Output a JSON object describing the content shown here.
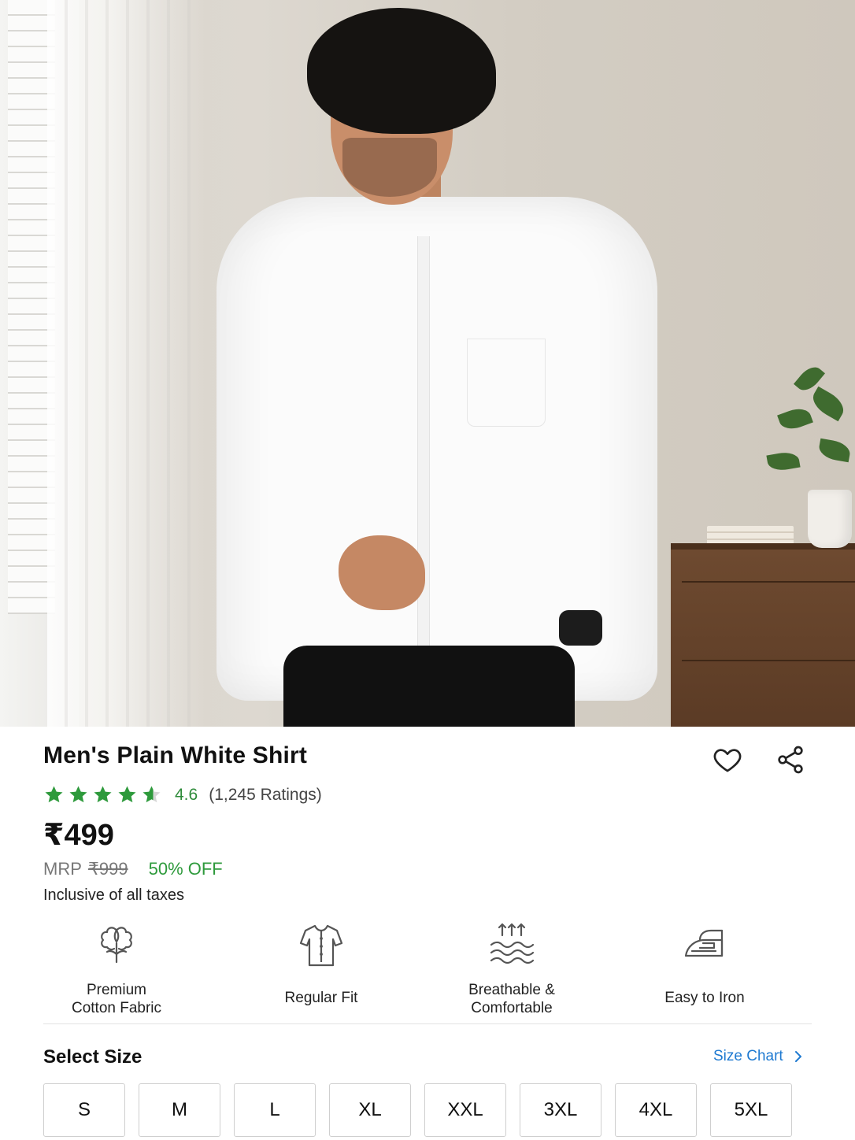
{
  "product": {
    "title": "Men's Plain White Shirt",
    "rating": "4.6",
    "rating_stars": 4.6,
    "ratings_count": "(1,245 Ratings)",
    "price": "₹499",
    "mrp_label": "MRP",
    "mrp_value": "₹999",
    "discount": "50% OFF",
    "tax_note": "Inclusive of all taxes"
  },
  "features": [
    {
      "label": "Premium\nCotton Fabric",
      "icon": "cotton-icon"
    },
    {
      "label": "Regular Fit",
      "icon": "shirt-icon"
    },
    {
      "label": "Breathable &\nComfortable",
      "icon": "airflow-icon"
    },
    {
      "label": "Easy to Iron",
      "icon": "iron-icon"
    }
  ],
  "size_section": {
    "title": "Select Size",
    "size_chart_label": "Size Chart",
    "sizes": [
      "S",
      "M",
      "L",
      "XL",
      "XXL",
      "3XL",
      "4XL",
      "5XL"
    ]
  },
  "colors": {
    "rating_green": "#2e8b3a",
    "discount_green": "#2e9a3c",
    "link_blue": "#1f7ad1",
    "star_green": "#2e9a3c"
  },
  "icons": {
    "wishlist": "heart-icon",
    "share": "share-icon",
    "size_chart_chevron": "chevron-right-icon"
  }
}
